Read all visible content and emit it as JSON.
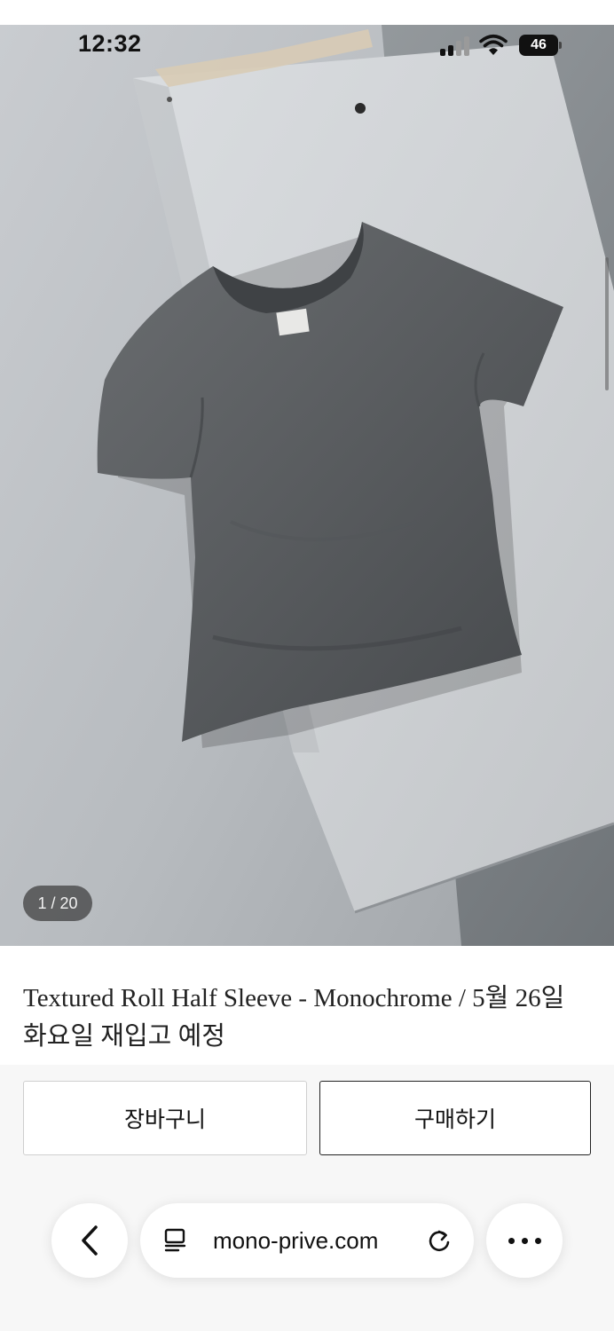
{
  "status_bar": {
    "time": "12:32",
    "battery": "46"
  },
  "product": {
    "image_counter": "1 / 20",
    "title": "Textured Roll Half Sleeve - Monochrome / 5월 26일 화요일 재입고 예정"
  },
  "actions": {
    "cart_label": "장바구니",
    "buy_label": "구매하기"
  },
  "browser": {
    "url": "mono-prive.com",
    "icons": [
      "chevron-left-icon",
      "reader-icon",
      "reload-icon",
      "more-icon"
    ]
  },
  "colors": {
    "panel_background": "#f7f7f7",
    "button_border_primary": "#222222",
    "button_border_secondary": "#cfcfcf"
  }
}
